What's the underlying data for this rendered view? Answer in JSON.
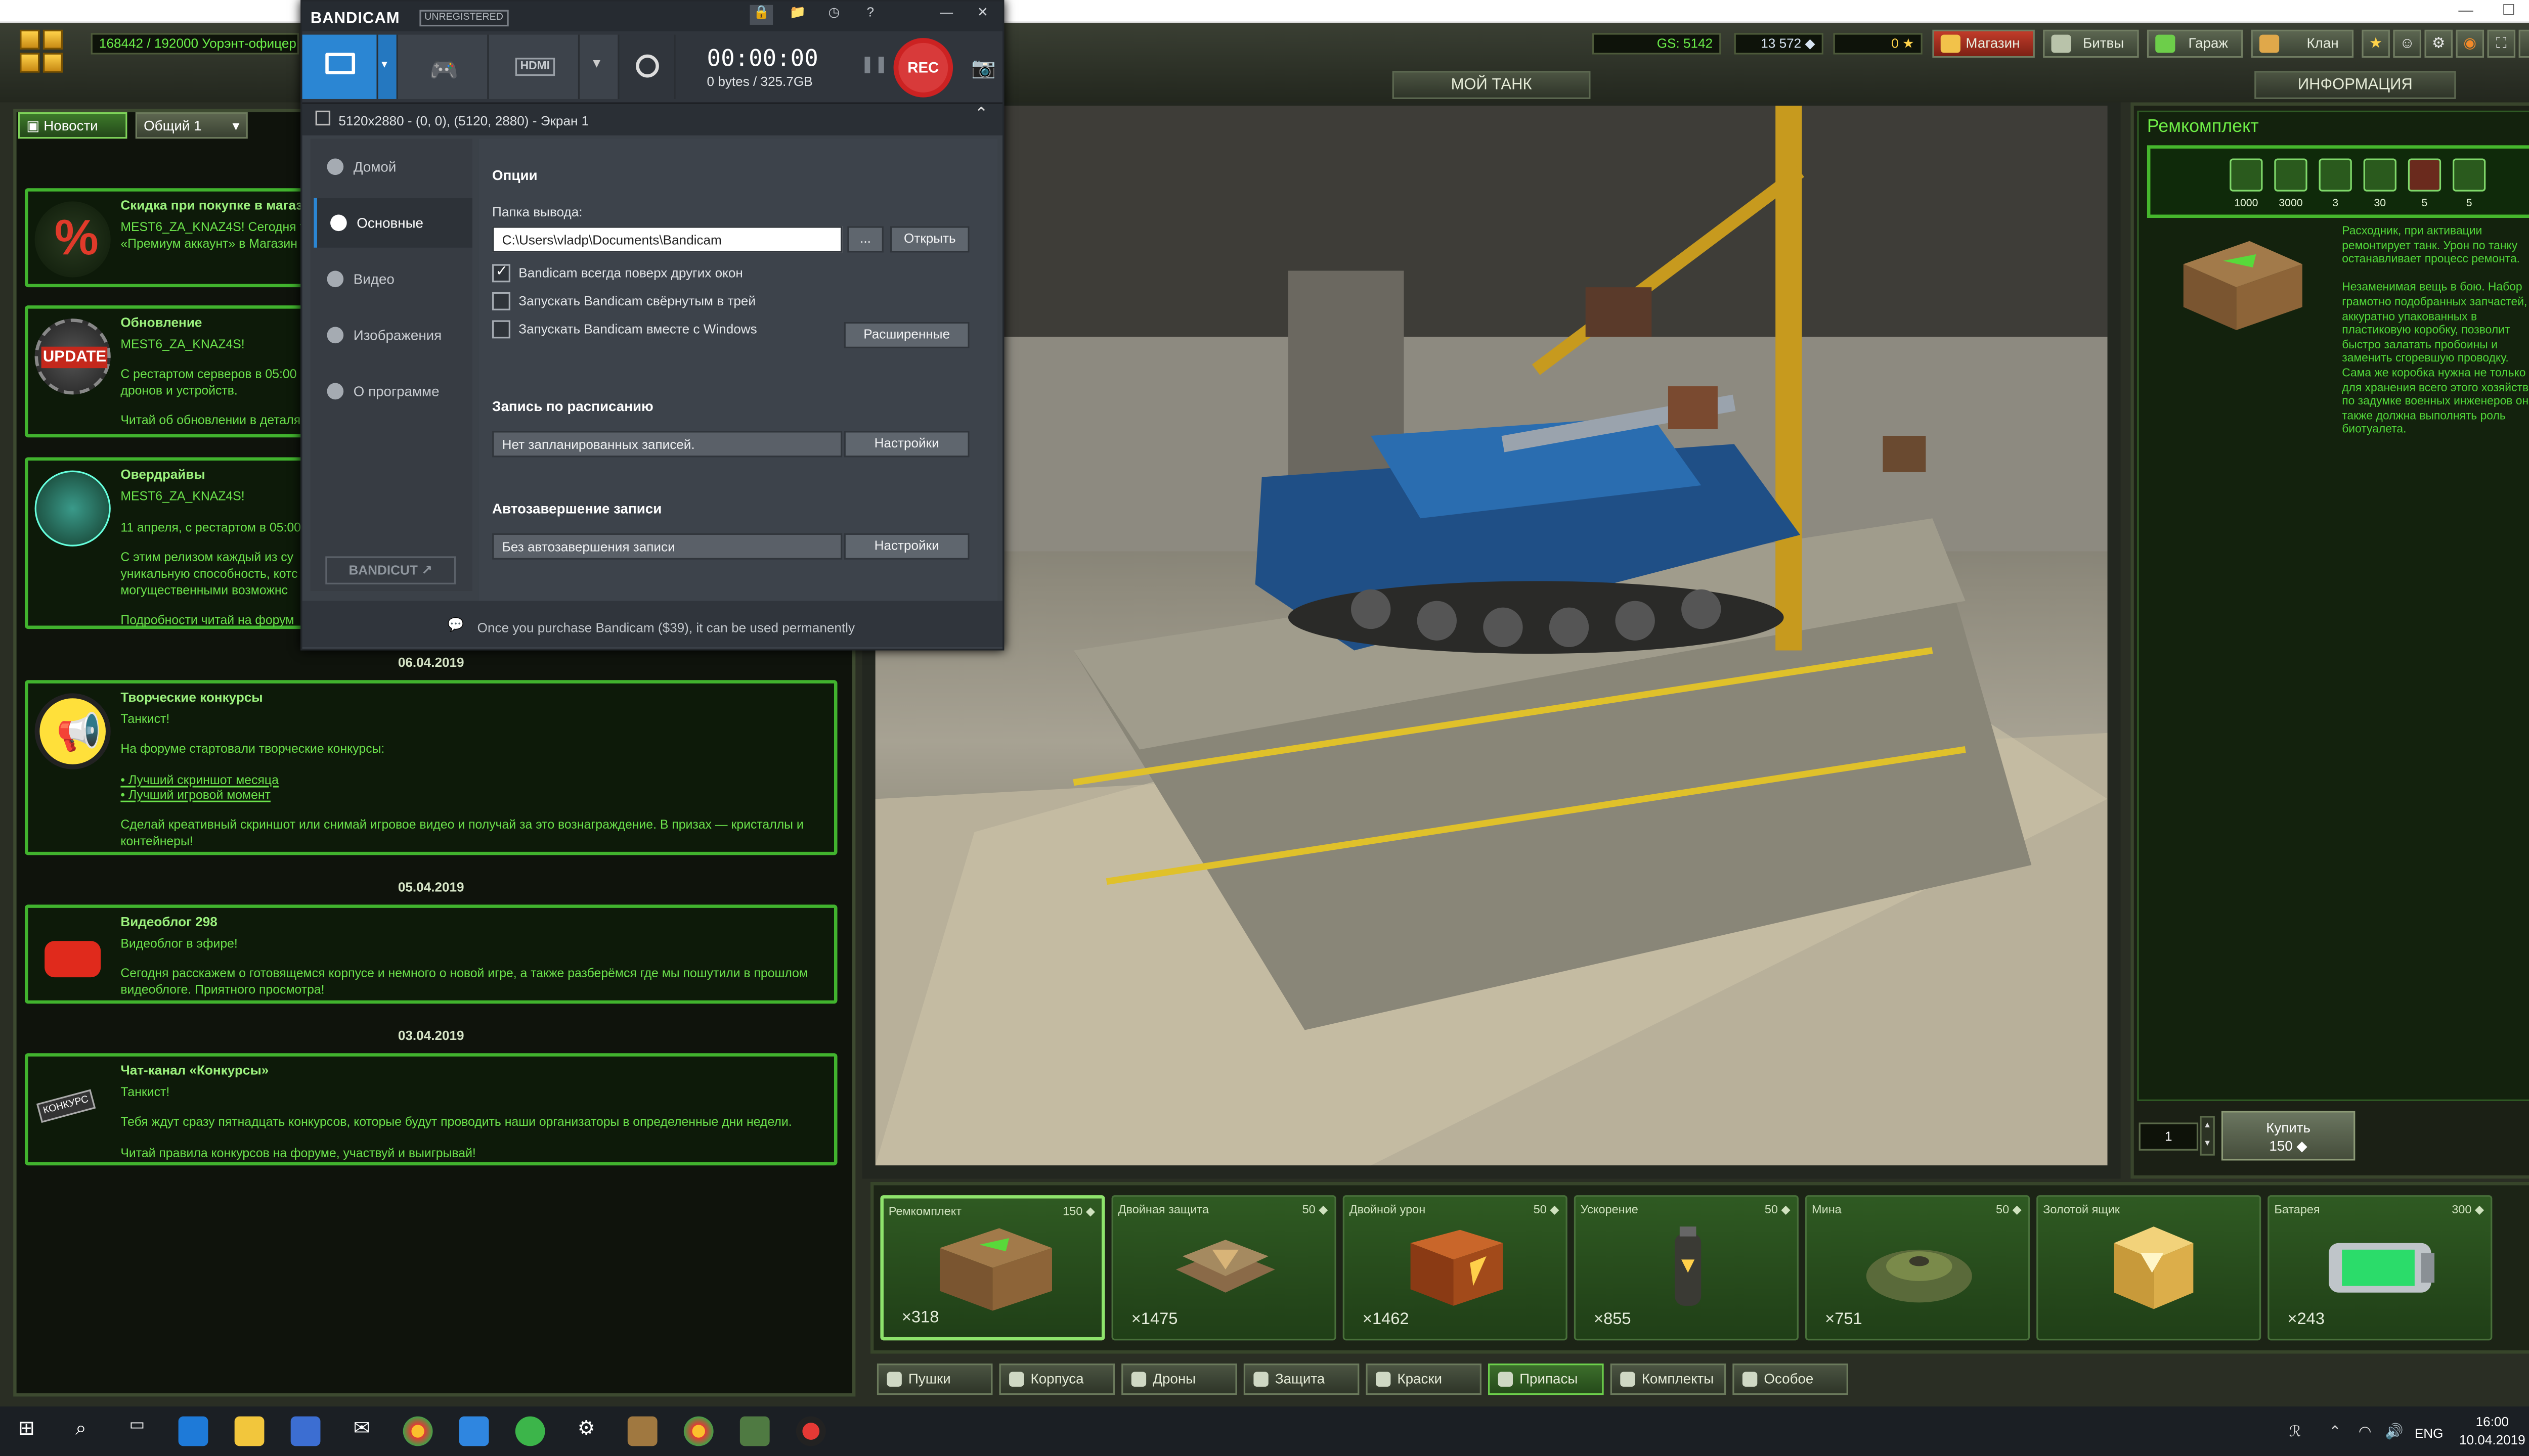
{
  "game": {
    "xp": "168442 / 192000  Уорэнт-офицер 5",
    "gs": "GS: 5142",
    "crystals": "13 572",
    "stars": "0",
    "buttons": [
      "Магазин",
      "Битвы",
      "Гараж",
      "Клан"
    ],
    "my_tank": "МОЙ ТАНК",
    "info": "ИНФОРМАЦИЯ",
    "window_controls": [
      "—",
      "☐",
      "✕"
    ]
  },
  "news_tabs": [
    "Новости",
    "Общий 1"
  ],
  "news": [
    {
      "title": "Скидка при покупке в магази",
      "lines": [
        "MEST6_ZA_KNAZ4S! Сегодня т",
        "«Премиум аккаунт» в Магазин"
      ]
    },
    {
      "title": "Обновление",
      "lines": [
        "MEST6_ZA_KNAZ4S!",
        "С рестартом серверов в 05:00",
        "дронов и устройств.",
        "Читай об обновлении в деталя"
      ],
      "icon_text": "UPDATE"
    },
    {
      "title": "Овердрайвы",
      "lines": [
        "MEST6_ZA_KNAZ4S!",
        "11 апреля, с рестартом в 05:00",
        "С этим релизом каждый из су",
        "уникальную способность, котс",
        "могущественными возможнс",
        "Подробности читай на  форум"
      ]
    },
    {
      "title": "Творческие конкурсы",
      "lines": [
        "Танкист!",
        "На форуме стартовали творческие конкурсы:",
        "• Лучший скриншот месяца",
        "• Лучший игровой момент",
        "Сделай креативный скриншот или снимай игровое видео и получай за это вознаграждение. В призах — кристаллы и",
        "контейнеры!"
      ]
    },
    {
      "title": "Видеоблог 298",
      "lines": [
        "Видеоблог в эфире!",
        "Сегодня расскажем о готовящемся корпусе и немного о новой игре, а также разберёмся где мы пошутили в прошлом",
        "видеоблоге. Приятного просмотра!"
      ]
    },
    {
      "title": "Чат-канал «Конкурсы»",
      "lines": [
        "Танкист!",
        "Тебя ждут сразу пятнадцать конкурсов, которые будут проводить наши организаторы в определенные дни недели.",
        "Читай правила конкурсов на  форуме, участвуй и выигрывай!"
      ],
      "icon_text": "КОНКУРС"
    }
  ],
  "dates": [
    "06.04.2019",
    "05.04.2019",
    "03.04.2019"
  ],
  "info_panel": {
    "title": "Ремкомплект",
    "props": [
      "1000",
      "3000",
      "3",
      "30",
      "5",
      "5"
    ],
    "desc_lines": [
      "Расходник, при активации",
      "ремонтирует танк. Урон по танку",
      "останавливает процесс ремонта.",
      "",
      "Незаменимая вещь в бою. Набор",
      "грамотно подобранных запчастей,",
      "аккуратно упакованных в",
      "пластиковую коробку, позволит",
      "быстро залатать пробоины и",
      "заменить сгоревшую проводку.",
      "Сама же коробка нужна не только",
      "для хранения всего этого хозяйства,",
      "по задумке военных инженеров она",
      "также должна выполнять роль",
      "биотуалета."
    ],
    "qty": "1",
    "buy_label": "Купить",
    "buy_price": "150"
  },
  "shop_items": [
    {
      "name": "Ремкомплект",
      "price": "150",
      "count": "×318"
    },
    {
      "name": "Двойная защита",
      "price": "50",
      "count": "×1475"
    },
    {
      "name": "Двойной урон",
      "price": "50",
      "count": "×1462"
    },
    {
      "name": "Ускорение",
      "price": "50",
      "count": "×855"
    },
    {
      "name": "Мина",
      "price": "50",
      "count": "×751"
    },
    {
      "name": "Золотой ящик",
      "price": "",
      "count": ""
    },
    {
      "name": "Батарея",
      "price": "300",
      "count": "×243"
    }
  ],
  "categories": [
    "Пушки",
    "Корпуса",
    "Дроны",
    "Защита",
    "Краски",
    "Припасы",
    "Комплекты",
    "Особое"
  ],
  "bandicam": {
    "logo": "BANDICAM",
    "unregistered": "UNREGISTERED",
    "timer": "00:00:00",
    "bytes": "0 bytes / 325.7GB",
    "rec": "REC",
    "mode_label": "HDMI",
    "screen": "5120x2880 - (0, 0), (5120, 2880) - Экран 1",
    "nav": [
      "Домой",
      "Основные",
      "Видео",
      "Изображения",
      "О программе"
    ],
    "cut": "BANDICUT ↗",
    "options_title": "Опции",
    "folder_label": "Папка вывода:",
    "folder_value": "C:\\Users\\vladp\\Documents\\Bandicam",
    "browse": "...",
    "open": "Открыть",
    "chk1": "Bandicam всегда поверх других окон",
    "chk2": "Запускать Bandicam свёрнутым в трей",
    "chk3": "Запускать Bandicam вместе с Windows",
    "advanced": "Расширенные",
    "sched_title": "Запись по расписанию",
    "sched_value": "Нет запланированных записей.",
    "settings": "Настройки",
    "auto_title": "Автозавершение записи",
    "auto_value": "Без автозавершения записи",
    "footer": "Once you purchase Bandicam ($39), it can be used permanently"
  },
  "taskbar": {
    "time": "16:00",
    "date": "10.04.2019",
    "lang": "ENG"
  }
}
